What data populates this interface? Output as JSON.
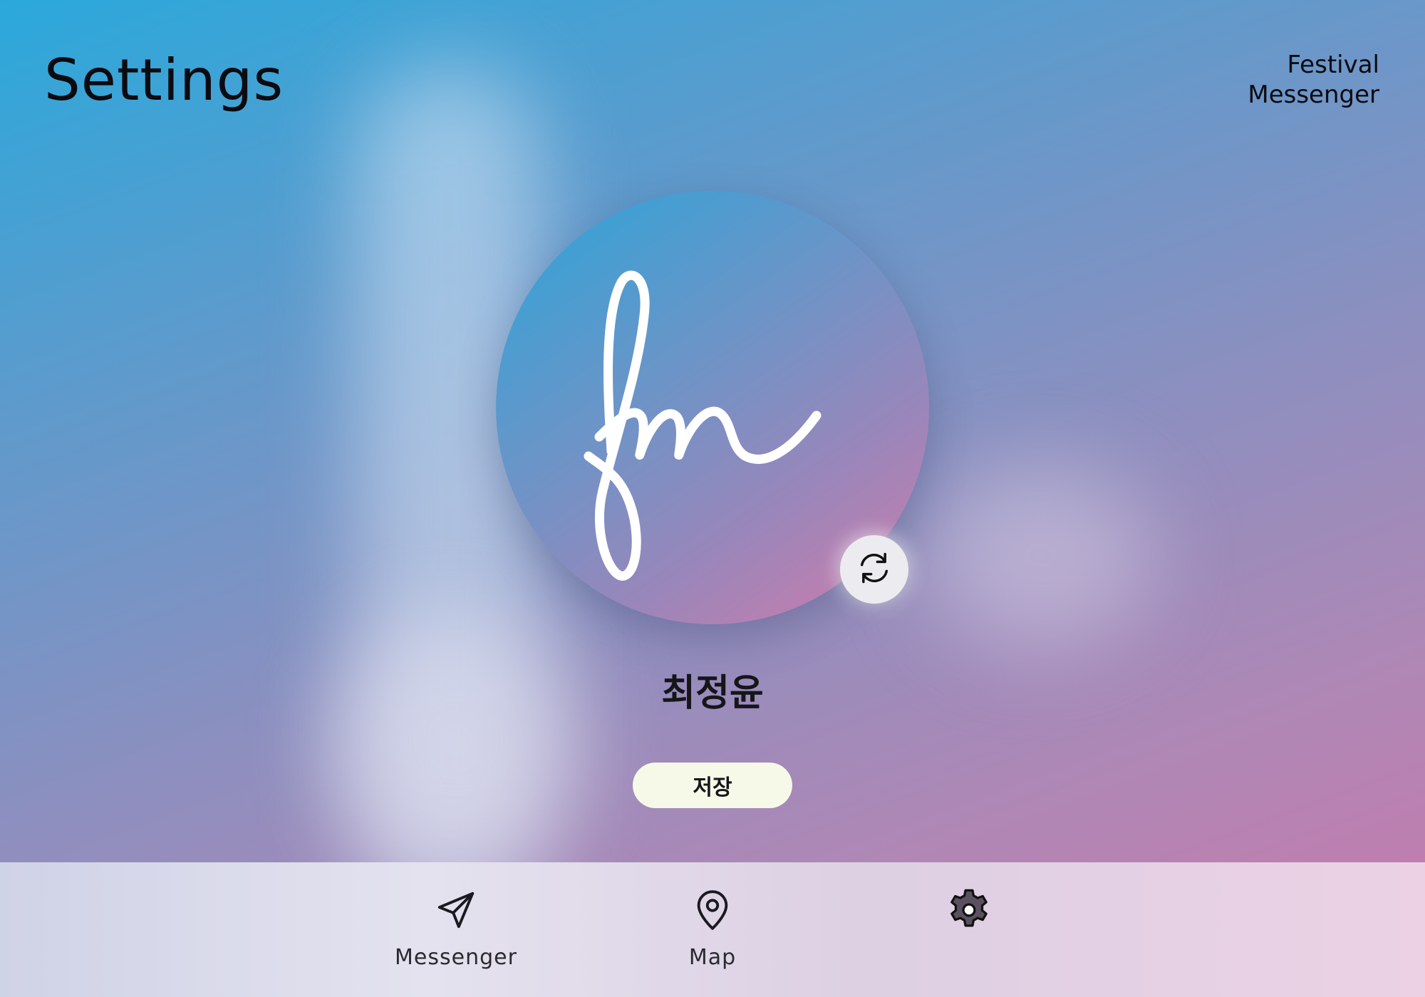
{
  "header": {
    "title": "Settings",
    "app_name_line1": "Festival",
    "app_name_line2": "Messenger"
  },
  "profile": {
    "logo_text": "fm",
    "refresh_icon": "refresh-icon",
    "user_name": "최정윤",
    "save_label": "저장"
  },
  "nav": {
    "items": [
      {
        "label": "Messenger",
        "icon": "send-icon"
      },
      {
        "label": "Map",
        "icon": "map-pin-icon"
      },
      {
        "label": "",
        "icon": "gear-icon",
        "active": true
      }
    ]
  },
  "colors": {
    "gradient_start": "#2ba8db",
    "gradient_end": "#c878ab",
    "save_button": "#f7f9e8",
    "nav_bar": "#e4e2ef",
    "active_icon": "#3a3340"
  }
}
